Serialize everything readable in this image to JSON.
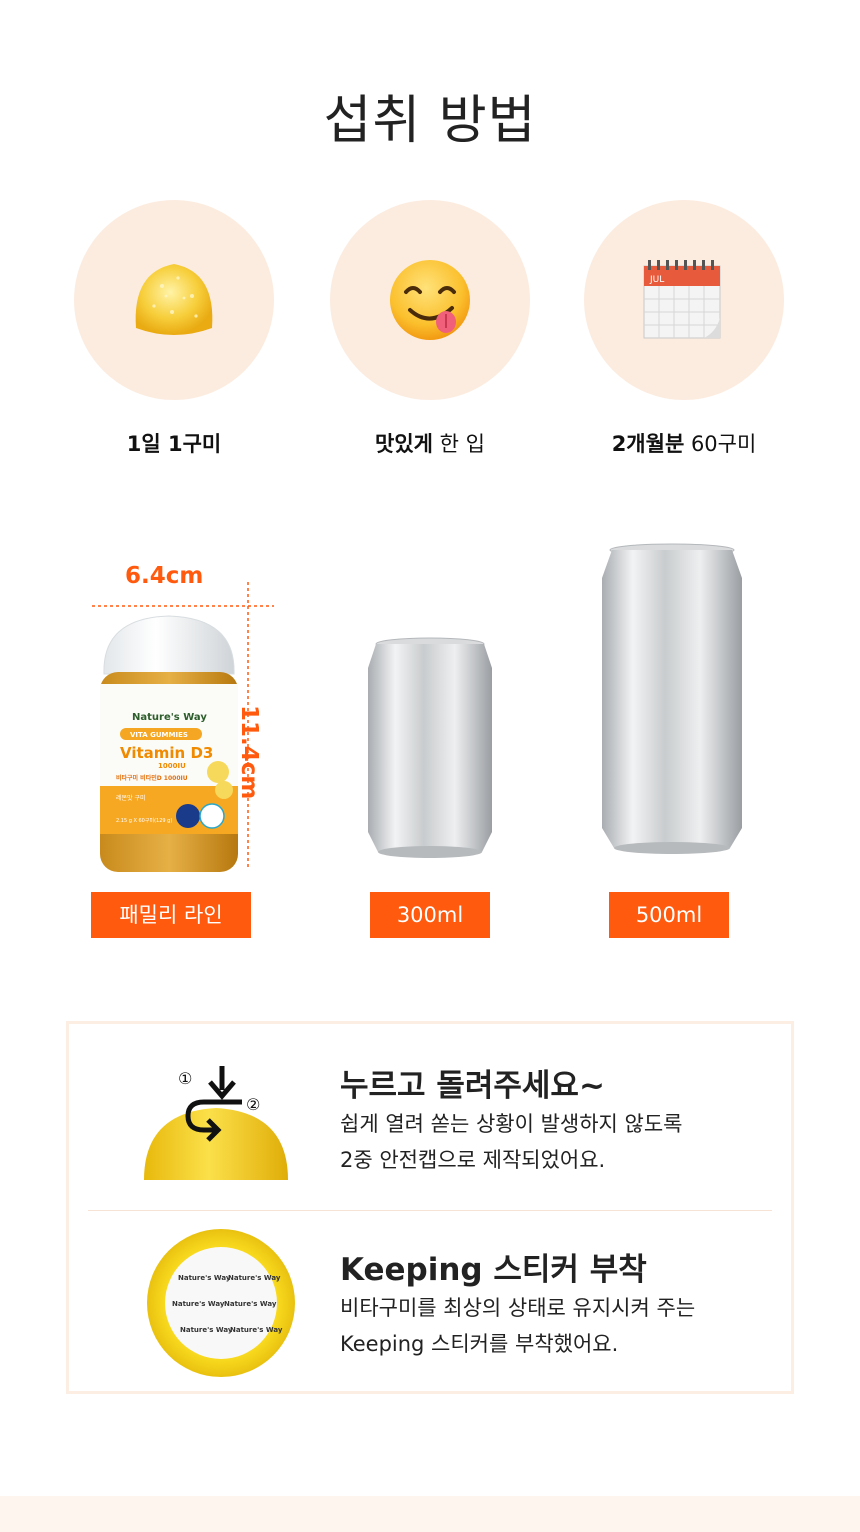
{
  "title": "섭취 방법",
  "steps": [
    {
      "bold": "1일 1구미",
      "rest": "",
      "icon": "gummy-icon"
    },
    {
      "bold": "맛있게",
      "rest": " 한 입",
      "icon": "yum-face-icon"
    },
    {
      "bold": "2개월분",
      "rest": " 60구미",
      "icon": "calendar-icon"
    }
  ],
  "calendar_month": "JUL",
  "size": {
    "width": "6.4cm",
    "height": "11.4cm"
  },
  "bottle": {
    "brand": "Nature's Way",
    "line": "VITA GUMMIES",
    "product": "Vitamin D3",
    "dose": "1000IU",
    "kr_name": "비타구미 비타민D 1000IU",
    "flavor": "레몬맛 구미",
    "amount": "2.15 g X 60구미(129 g)"
  },
  "compare": [
    {
      "label": "패밀리 라인"
    },
    {
      "label": "300ml"
    },
    {
      "label": "500ml"
    }
  ],
  "features": [
    {
      "title": "누르고 돌려주세요~",
      "lines": [
        "쉽게 열려 쏟는 상황이 발생하지 않도록",
        "2중 안전캡으로 제작되었어요."
      ],
      "steps": [
        "①",
        "②"
      ]
    },
    {
      "title": "Keeping 스티커 부착",
      "lines": [
        "비타구미를 최상의 상태로 유지시켜 주는",
        "Keeping 스티커를 부착했어요."
      ],
      "sticker_text": "Nature's Way"
    }
  ],
  "colors": {
    "accent": "#ff5a0e",
    "circle_bg": "#fcece0",
    "cap_yellow": "#f5d223"
  }
}
